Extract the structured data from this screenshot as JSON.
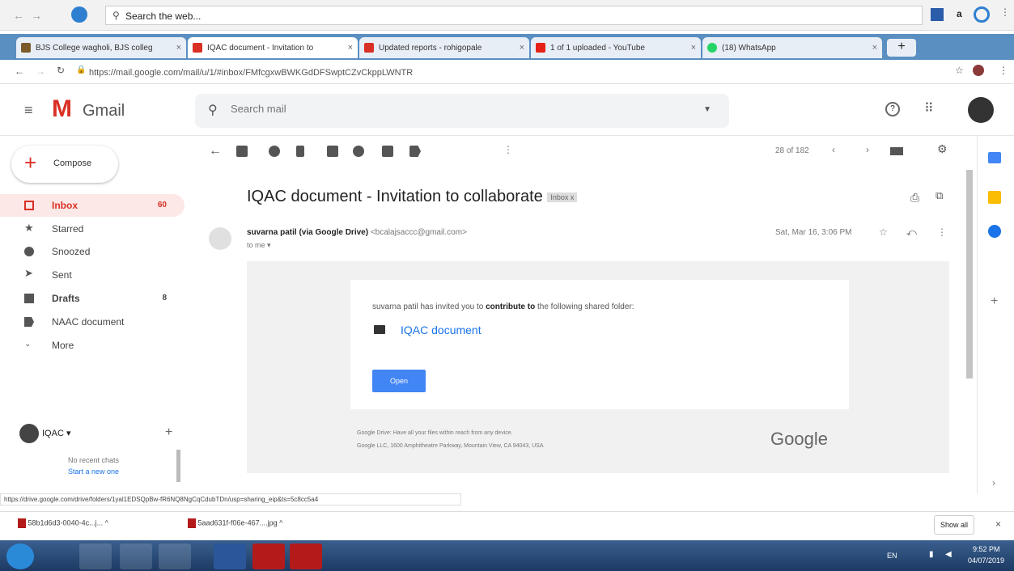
{
  "ie": {
    "search_placeholder": "Search the web..."
  },
  "tabs": [
    {
      "label": "BJS College wagholi, BJS colleg",
      "color": "#7b5b2a"
    },
    {
      "label": "IQAC document - Invitation to",
      "color": "#d93025"
    },
    {
      "label": "Updated reports - rohigopale",
      "color": "#d93025"
    },
    {
      "label": "1 of 1 uploaded - YouTube",
      "color": "#e62117"
    },
    {
      "label": "(18) WhatsApp",
      "color": "#25d366"
    }
  ],
  "url": "https://mail.google.com/mail/u/1/#inbox/FMfcgxwBWKGdDFSwptCZvCkppLWNTR",
  "gmail": {
    "logo_text": "Gmail",
    "search_placeholder": "Search mail"
  },
  "sidebar": {
    "compose": "Compose",
    "items": [
      {
        "label": "Inbox",
        "count": "60"
      },
      {
        "label": "Starred",
        "count": ""
      },
      {
        "label": "Snoozed",
        "count": ""
      },
      {
        "label": "Sent",
        "count": ""
      },
      {
        "label": "Drafts",
        "count": "8"
      },
      {
        "label": "NAAC document",
        "count": ""
      },
      {
        "label": "More",
        "count": ""
      }
    ],
    "chat_user": "IQAC",
    "no_chats": "No recent chats",
    "start_new": "Start a new one"
  },
  "toolbar": {
    "pager": "28 of 182"
  },
  "email": {
    "subject": "IQAC document - Invitation to collaborate",
    "label": "Inbox x",
    "sender": "suvarna patil (via Google Drive)",
    "sender_email": "<bcalajsaccc@gmail.com>",
    "to": "to me",
    "date": "Sat, Mar 16, 3:06 PM",
    "invite_pre": "suvarna patil has invited you to",
    "invite_bold": "contribute to",
    "invite_post": "the following shared folder:",
    "folder": "IQAC document",
    "open": "Open",
    "footer1": "Google Drive: Have all your files within reach from any device.",
    "footer2": "Google LLC, 1600 Amphitheatre Parkway, Mountain View, CA 94043, USA",
    "google": "Google"
  },
  "status_url": "https://drive.google.com/drive/folders/1yal1EDSQpBw-fR6NQ8NgCqCdubTDn/usp=sharing_eip&ts=5c8cc5a4",
  "downloads": [
    {
      "label": "58b1d6d3-0040-4c...j..."
    },
    {
      "label": "5aad631f-f06e-467....jpg"
    }
  ],
  "show_all": "Show all",
  "tray": {
    "lang": "EN",
    "time": "9:52 PM",
    "date": "04/07/2019"
  }
}
